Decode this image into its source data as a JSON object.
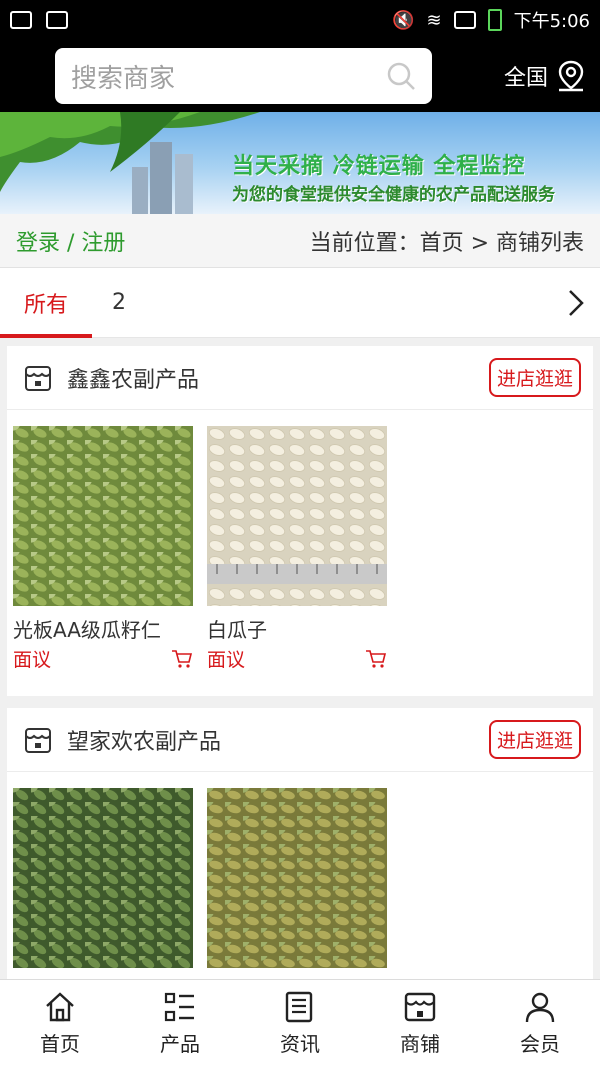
{
  "status_bar": {
    "time": "下午5:06"
  },
  "header": {
    "search_placeholder": "搜索商家",
    "region": "全国"
  },
  "banner": {
    "slogan_line1": "当天采摘 冷链运输 全程监控",
    "slogan_line2": "为您的食堂提供安全健康的农产品配送服务"
  },
  "crumb": {
    "login": "登录 / 注册",
    "location": "当前位置：首页 > 商铺列表"
  },
  "tabs": [
    {
      "label": "所有"
    },
    {
      "label": "2"
    }
  ],
  "colors": {
    "accent": "#d7191c",
    "green": "#2e9b2e"
  },
  "shops": [
    {
      "name": "鑫鑫农副产品",
      "visit_label": "进店逛逛",
      "products": [
        {
          "name": "光板AA级瓜籽仁",
          "price": "面议"
        },
        {
          "name": "白瓜子",
          "price": "面议"
        }
      ]
    },
    {
      "name": "望家欢农副产品",
      "visit_label": "进店逛逛",
      "products": [
        {
          "name": "",
          "price": ""
        },
        {
          "name": "",
          "price": ""
        }
      ]
    }
  ],
  "bottom_nav": [
    {
      "label": "首页",
      "icon": "home-icon"
    },
    {
      "label": "产品",
      "icon": "list-icon"
    },
    {
      "label": "资讯",
      "icon": "news-icon"
    },
    {
      "label": "商铺",
      "icon": "shop-icon"
    },
    {
      "label": "会员",
      "icon": "user-icon"
    }
  ]
}
